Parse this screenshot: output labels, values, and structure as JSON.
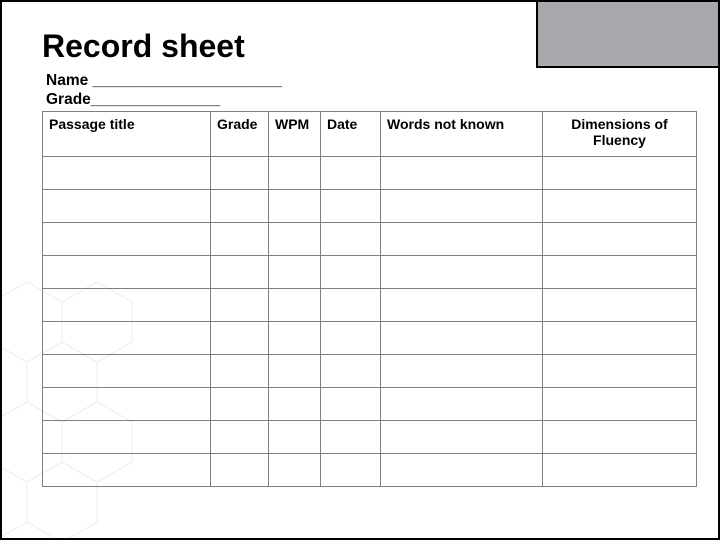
{
  "title": "Record sheet",
  "fields": {
    "name_label": "Name ______________________",
    "grade_label": "Grade_______________"
  },
  "table": {
    "headers": {
      "passage_title": "Passage title",
      "grade": "Grade",
      "wpm": "WPM",
      "date": "Date",
      "words_not_known": "Words not known",
      "dimensions": "Dimensions of Fluency"
    },
    "rows": [
      {
        "passage_title": "",
        "grade": "",
        "wpm": "",
        "date": "",
        "words_not_known": "",
        "dimensions": ""
      },
      {
        "passage_title": "",
        "grade": "",
        "wpm": "",
        "date": "",
        "words_not_known": "",
        "dimensions": ""
      },
      {
        "passage_title": "",
        "grade": "",
        "wpm": "",
        "date": "",
        "words_not_known": "",
        "dimensions": ""
      },
      {
        "passage_title": "",
        "grade": "",
        "wpm": "",
        "date": "",
        "words_not_known": "",
        "dimensions": ""
      },
      {
        "passage_title": "",
        "grade": "",
        "wpm": "",
        "date": "",
        "words_not_known": "",
        "dimensions": ""
      },
      {
        "passage_title": "",
        "grade": "",
        "wpm": "",
        "date": "",
        "words_not_known": "",
        "dimensions": ""
      },
      {
        "passage_title": "",
        "grade": "",
        "wpm": "",
        "date": "",
        "words_not_known": "",
        "dimensions": ""
      },
      {
        "passage_title": "",
        "grade": "",
        "wpm": "",
        "date": "",
        "words_not_known": "",
        "dimensions": ""
      },
      {
        "passage_title": "",
        "grade": "",
        "wpm": "",
        "date": "",
        "words_not_known": "",
        "dimensions": ""
      },
      {
        "passage_title": "",
        "grade": "",
        "wpm": "",
        "date": "",
        "words_not_known": "",
        "dimensions": ""
      }
    ]
  }
}
